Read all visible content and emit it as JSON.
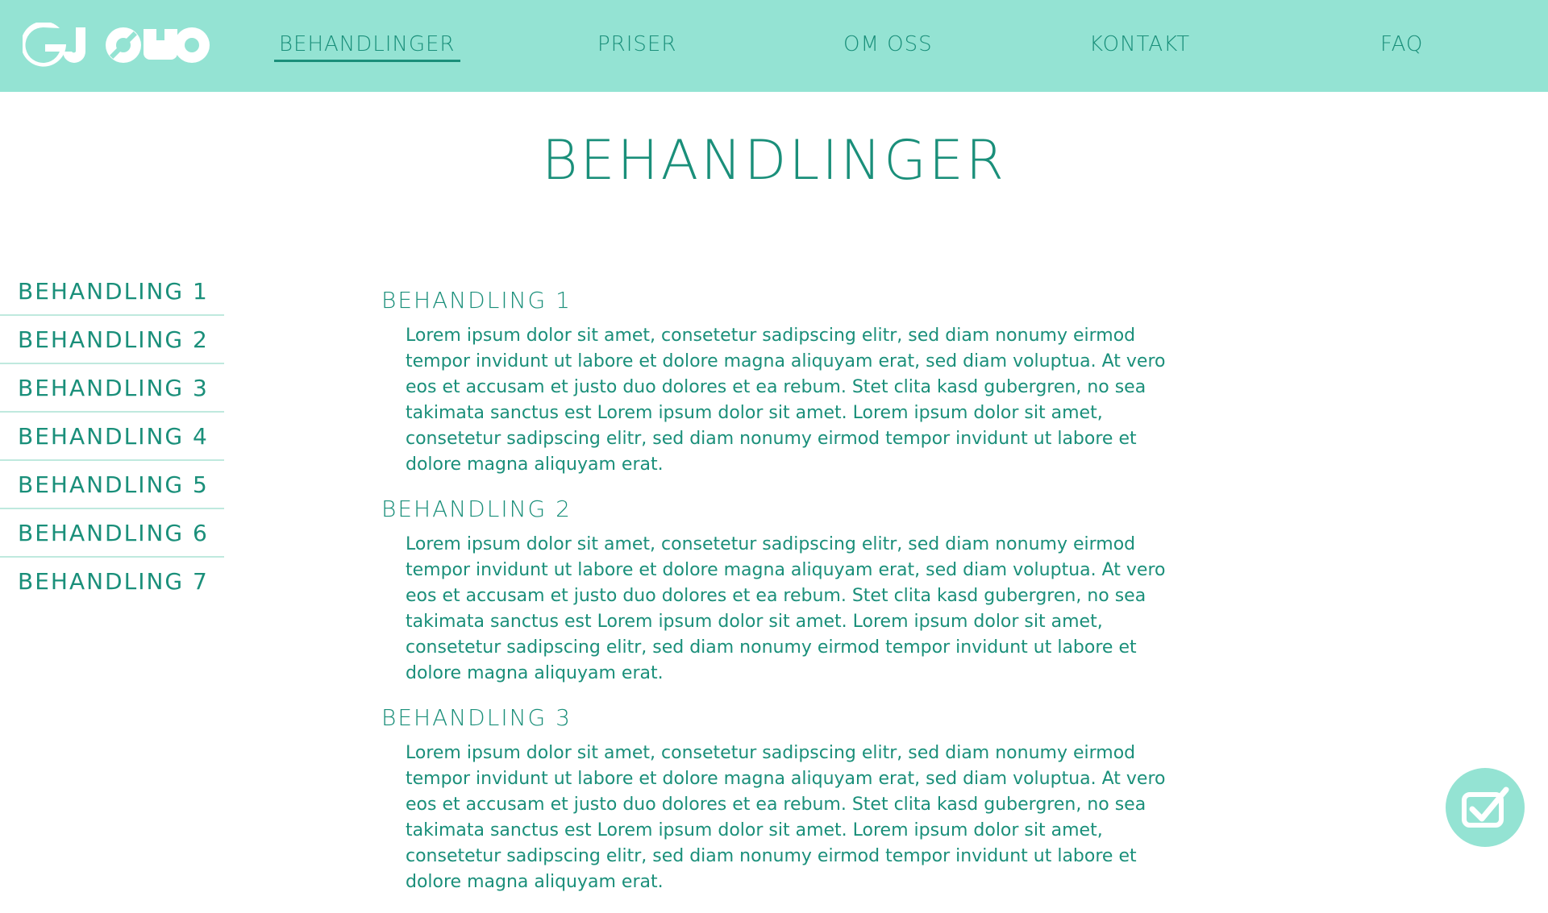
{
  "header": {
    "logo_text": "GJØNO",
    "nav": [
      {
        "label": "BEHANDLINGER",
        "active": true
      },
      {
        "label": "PRISER"
      },
      {
        "label": "OM OSS"
      },
      {
        "label": "KONTAKT"
      },
      {
        "label": "FAQ"
      }
    ]
  },
  "page": {
    "title": "BEHANDLINGER"
  },
  "sidebar": {
    "items": [
      {
        "label": "BEHANDLING 1"
      },
      {
        "label": "BEHANDLING 2"
      },
      {
        "label": "BEHANDLING 3"
      },
      {
        "label": "BEHANDLING 4"
      },
      {
        "label": "BEHANDLING 5"
      },
      {
        "label": "BEHANDLING 6"
      },
      {
        "label": "BEHANDLING 7"
      }
    ]
  },
  "sections": [
    {
      "title": "BEHANDLING 1",
      "body": "Lorem ipsum dolor sit amet, consetetur sadipscing elitr, sed diam nonumy eirmod tempor invidunt ut labore et dolore magna aliquyam erat, sed diam voluptua. At vero eos et accusam et justo duo dolores et ea rebum. Stet clita kasd gubergren, no sea takimata sanctus est Lorem ipsum dolor sit amet. Lorem ipsum dolor sit amet, consetetur sadipscing elitr, sed diam nonumy eirmod tempor invidunt ut labore et dolore magna aliquyam erat."
    },
    {
      "title": "BEHANDLING 2",
      "body": "Lorem ipsum dolor sit amet, consetetur sadipscing elitr, sed diam nonumy eirmod tempor invidunt ut labore et dolore magna aliquyam erat, sed diam voluptua. At vero eos et accusam et justo duo dolores et ea rebum. Stet clita kasd gubergren, no sea takimata sanctus est Lorem ipsum dolor sit amet. Lorem ipsum dolor sit amet, consetetur sadipscing elitr, sed diam nonumy eirmod tempor invidunt ut labore et dolore magna aliquyam erat."
    },
    {
      "title": "BEHANDLING 3",
      "body": "Lorem ipsum dolor sit amet, consetetur sadipscing elitr, sed diam nonumy eirmod tempor invidunt ut labore et dolore magna aliquyam erat, sed diam voluptua. At vero eos et accusam et justo duo dolores et ea rebum. Stet clita kasd gubergren, no sea takimata sanctus est Lorem ipsum dolor sit amet. Lorem ipsum dolor sit amet, consetetur sadipscing elitr, sed diam nonumy eirmod tempor invidunt ut labore et dolore magna aliquyam erat."
    }
  ],
  "fab": {
    "icon": "checkbox-check-icon"
  },
  "colors": {
    "accent": "#94e3d3",
    "text": "#1a8f7a",
    "divider": "#bfe9de"
  }
}
